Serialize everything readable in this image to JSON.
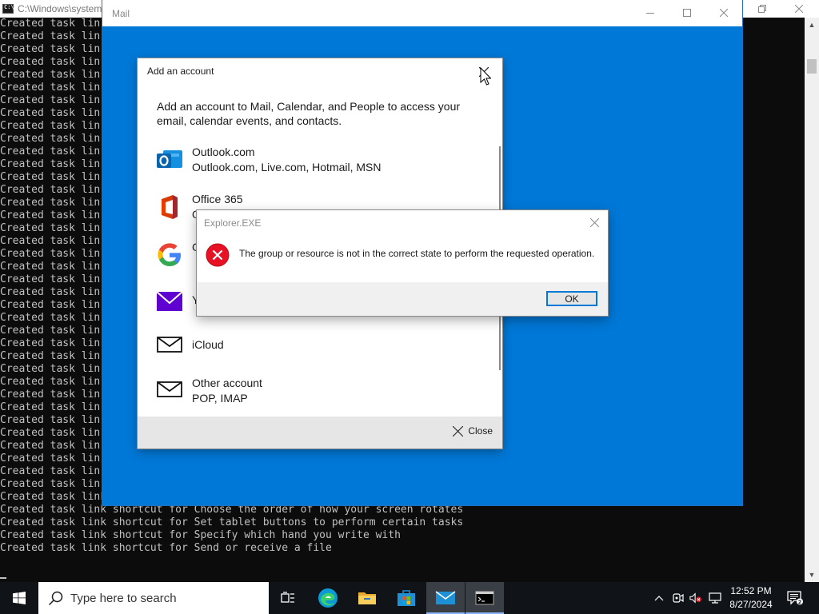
{
  "console": {
    "title": "C:\\Windows\\system",
    "lines": [
      "Created task lin",
      "Created task lin",
      "Created task lin",
      "Created task lin",
      "Created task lin",
      "Created task lin",
      "Created task lin",
      "Created task lin",
      "Created task lin",
      "Created task lin",
      "Created task lin",
      "Created task lin",
      "Created task lin",
      "Created task lin",
      "Created task lin",
      "Created task lin",
      "Created task lin",
      "Created task lin",
      "Created task lin",
      "Created task lin",
      "Created task lin",
      "Created task lin",
      "Created task lin",
      "Created task lin",
      "Created task lin",
      "Created task lin",
      "Created task lin",
      "Created task lin",
      "Created task lin",
      "Created task lin",
      "Created task lin",
      "Created task lin",
      "Created task lin",
      "Created task lin",
      "Created task lin",
      "Created task lin",
      "Created task lin",
      "Created task link shortcut for Calibrate the screen for pen or touch input",
      "Created task link shortcut for Choose the order of how your screen rotates",
      "Created task link shortcut for Set tablet buttons to perform certain tasks",
      "Created task link shortcut for Specify which hand you write with",
      "Created task link shortcut for Send or receive a file"
    ]
  },
  "mail": {
    "title": "Mail"
  },
  "add_account": {
    "title": "Add an account",
    "description": "Add an account to Mail, Calendar, and People to access your email, calendar events, and contacts.",
    "providers": [
      {
        "name": "Outlook.com",
        "sub": "Outlook.com, Live.com, Hotmail, MSN",
        "icon": "outlook-icon"
      },
      {
        "name": "Office 365",
        "sub": "O",
        "icon": "office-icon"
      },
      {
        "name": "G",
        "sub": "",
        "icon": "google-icon"
      },
      {
        "name": "Y",
        "sub": "",
        "icon": "yahoo-icon"
      },
      {
        "name": "iCloud",
        "sub": "",
        "icon": "mail-envelope-icon"
      },
      {
        "name": "Other account",
        "sub": "POP, IMAP",
        "icon": "mail-envelope-icon"
      }
    ],
    "close_label": "Close"
  },
  "error_dialog": {
    "title": "Explorer.EXE",
    "message": "The group or resource is not in the correct state to perform the requested operation.",
    "ok_label": "OK"
  },
  "taskbar": {
    "search_placeholder": "Type here to search",
    "apps": [
      "task-view-icon",
      "edge-icon",
      "file-explorer-icon",
      "store-icon",
      "mail-icon",
      "console-icon"
    ],
    "time": "12:52 PM",
    "date": "8/27/2024"
  },
  "colors": {
    "mail_blue": "#0078d7",
    "error_red": "#e81123",
    "taskbar": "#101419"
  }
}
